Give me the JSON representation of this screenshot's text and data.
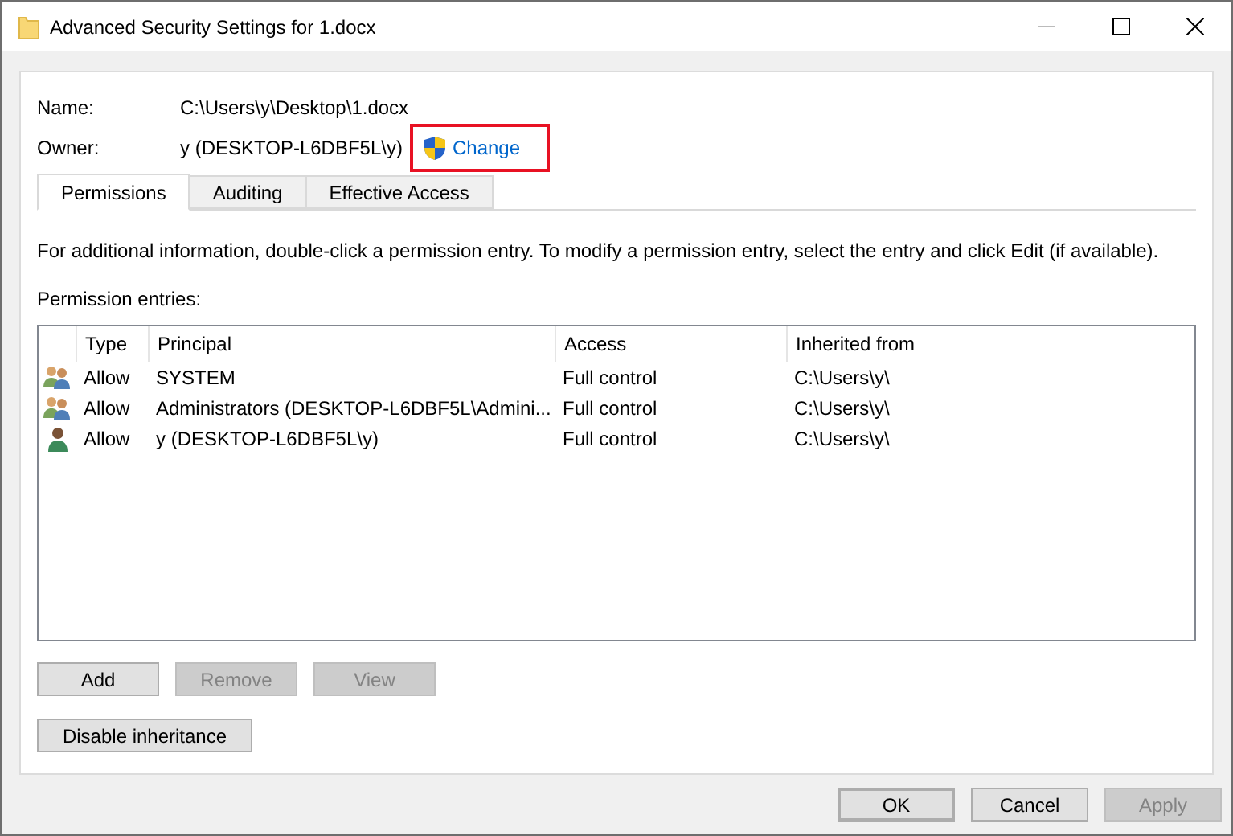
{
  "window": {
    "title": "Advanced Security Settings for 1.docx"
  },
  "name": {
    "label": "Name:",
    "value": "C:\\Users\\y\\Desktop\\1.docx"
  },
  "owner": {
    "label": "Owner:",
    "value": "y (DESKTOP-L6DBF5L\\y)",
    "change_link": "Change",
    "highlighted": true
  },
  "tabs": [
    {
      "label": "Permissions",
      "selected": true
    },
    {
      "label": "Auditing",
      "selected": false
    },
    {
      "label": "Effective Access",
      "selected": false
    }
  ],
  "instructions": "For additional information, double-click a permission entry. To modify a permission entry, select the entry and click Edit (if available).",
  "entries_label": "Permission entries:",
  "table": {
    "columns": [
      "Type",
      "Principal",
      "Access",
      "Inherited from"
    ],
    "rows": [
      {
        "kind": "group",
        "type": "Allow",
        "principal": "SYSTEM",
        "access": "Full control",
        "inherited_from": "C:\\Users\\y\\"
      },
      {
        "kind": "group",
        "type": "Allow",
        "principal": "Administrators (DESKTOP-L6DBF5L\\Admini...",
        "access": "Full control",
        "inherited_from": "C:\\Users\\y\\"
      },
      {
        "kind": "user",
        "type": "Allow",
        "principal": "y (DESKTOP-L6DBF5L\\y)",
        "access": "Full control",
        "inherited_from": "C:\\Users\\y\\"
      }
    ]
  },
  "entry_buttons": [
    {
      "label": "Add",
      "disabled": false
    },
    {
      "label": "Remove",
      "disabled": true
    },
    {
      "label": "View",
      "disabled": true
    }
  ],
  "inheritance_button": "Disable inheritance",
  "dialog_buttons": [
    {
      "label": "OK",
      "disabled": false,
      "default": true
    },
    {
      "label": "Cancel",
      "disabled": false,
      "default": false
    },
    {
      "label": "Apply",
      "disabled": true,
      "default": false
    }
  ]
}
